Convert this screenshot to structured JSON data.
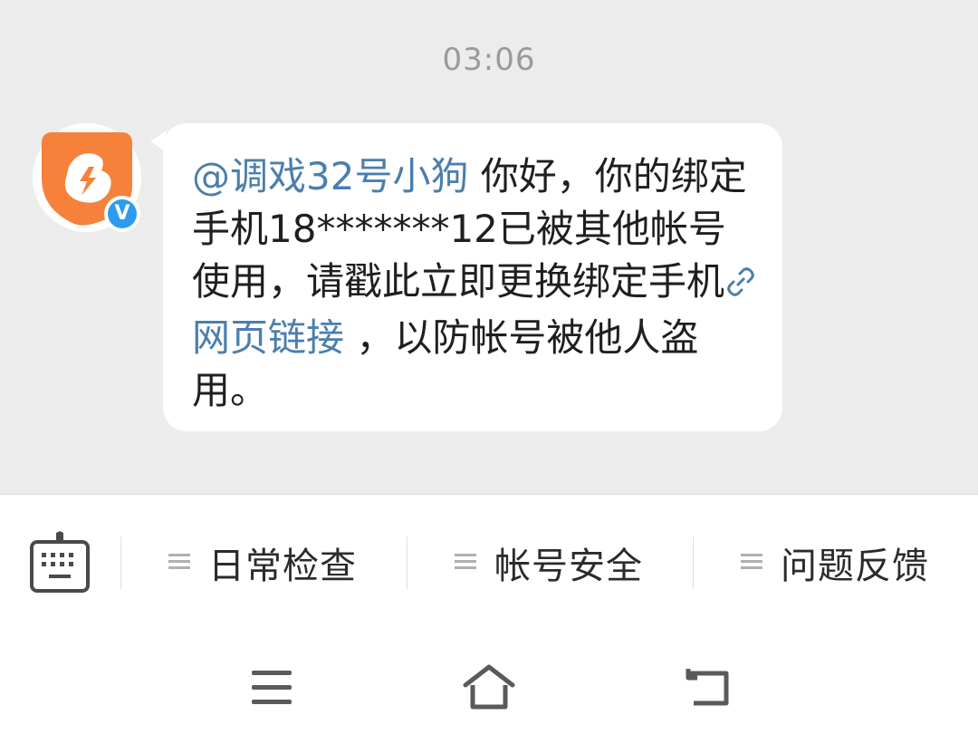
{
  "timestamp": "03:06",
  "sender": {
    "avatar_icon": "orange-lightning-logo-icon",
    "avatar_color": "#f5813b",
    "verified_badge": "V",
    "verified_color": "#2d9cf0"
  },
  "message": {
    "mention": "@调戏32号小狗",
    "text_1": " 你好，你的绑定手机18*******12已被其他帐号使用，请戳此立即更换绑定手机",
    "link_icon": "link-icon",
    "link_text": "网页链接",
    "text_2": " ，以防帐号被他人盗用。",
    "link_color": "#4a7fad"
  },
  "bottom_menu": {
    "keyboard_icon": "keyboard-icon",
    "items": [
      {
        "label": "日常检查",
        "icon": "menu-lines-icon"
      },
      {
        "label": "帐号安全",
        "icon": "menu-lines-icon"
      },
      {
        "label": "问题反馈",
        "icon": "menu-lines-icon"
      }
    ]
  },
  "nav_bar": {
    "menu_icon": "hamburger-icon",
    "home_icon": "home-icon",
    "back_icon": "back-icon"
  }
}
